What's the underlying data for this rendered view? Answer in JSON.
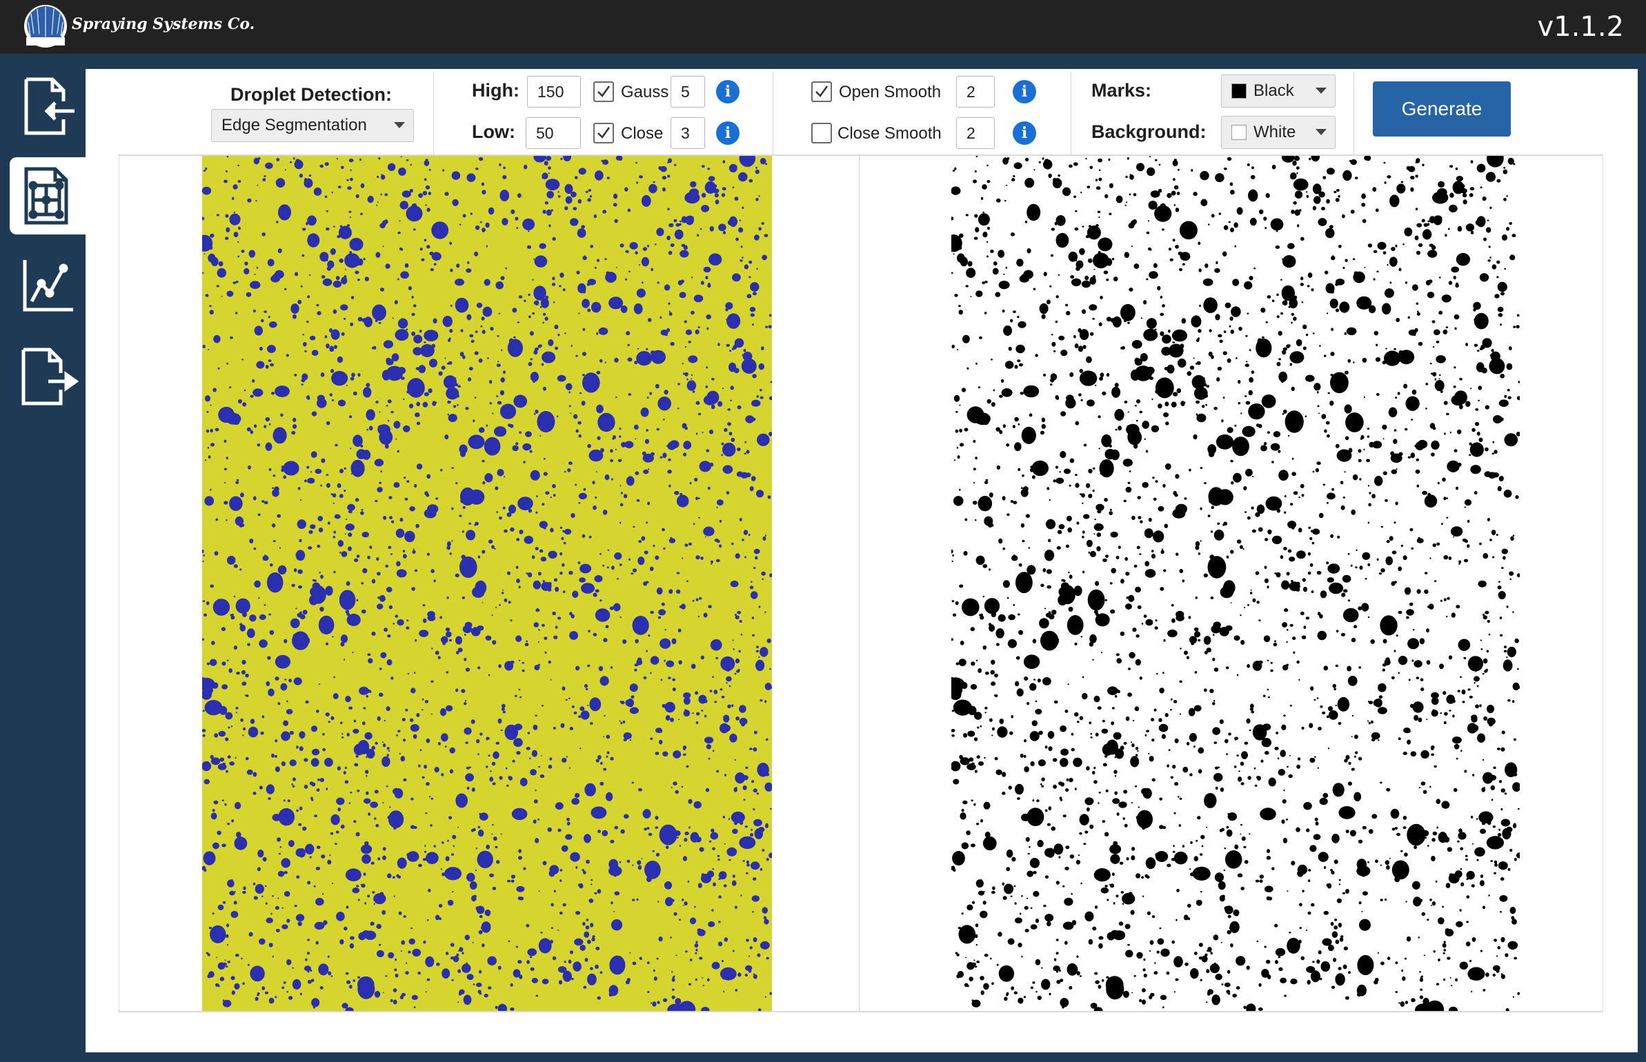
{
  "app": {
    "brand": "Spraying Systems Co.",
    "version": "v1.1.2"
  },
  "sidebar": {
    "items": [
      {
        "name": "import",
        "icon": "file-import-icon"
      },
      {
        "name": "analysis",
        "icon": "grid-analysis-icon",
        "active": true
      },
      {
        "name": "charts",
        "icon": "line-chart-icon"
      },
      {
        "name": "export",
        "icon": "file-export-icon"
      }
    ]
  },
  "toolbar": {
    "detection_label": "Droplet Detection:",
    "detection_value": "Edge Segmentation",
    "high_label": "High:",
    "high_value": "150",
    "low_label": "Low:",
    "low_value": "50",
    "gauss": {
      "label": "Gauss",
      "checked": true,
      "value": "5"
    },
    "close": {
      "label": "Close",
      "checked": true,
      "value": "3"
    },
    "open_smooth": {
      "label": "Open Smooth",
      "checked": true,
      "value": "2"
    },
    "close_smooth": {
      "label": "Close Smooth",
      "checked": false,
      "value": "2"
    },
    "info_glyph": "i",
    "marks_label": "Marks:",
    "marks_value": "Black",
    "background_label": "Background:",
    "background_value": "White",
    "generate_label": "Generate"
  },
  "colors": {
    "topbar": "#222222",
    "sidebar": "#1e3a55",
    "accent": "#2764a6",
    "info": "#1a6fd6",
    "paper_yellow": "#d6d42e",
    "droplet_blue": "#2a2fb0",
    "mark_black": "#000000"
  }
}
